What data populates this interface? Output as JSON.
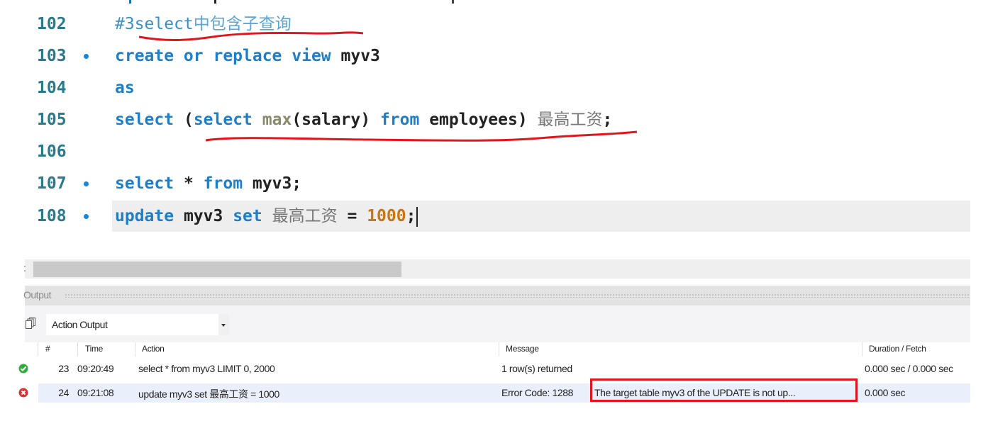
{
  "editor": {
    "lines": [
      {
        "number": "102",
        "breakpoint": false,
        "comment": "#3select中包含子查询"
      },
      {
        "number": "103",
        "breakpoint": true,
        "tokens": [
          "create or replace view",
          "myv3"
        ]
      },
      {
        "number": "104",
        "breakpoint": false,
        "tokens": [
          "as"
        ]
      },
      {
        "number": "105",
        "breakpoint": false,
        "tokens": [
          "select",
          "(",
          "select",
          "max",
          "(salary)",
          "from",
          "employees)",
          "最高工资",
          ";"
        ]
      },
      {
        "number": "106",
        "breakpoint": false,
        "tokens": []
      },
      {
        "number": "107",
        "breakpoint": true,
        "tokens": [
          "select",
          "*",
          "from",
          "myv3;"
        ]
      },
      {
        "number": "108",
        "breakpoint": true,
        "current": true,
        "tokens": [
          "update",
          "myv3",
          "set",
          "最高工资",
          "=",
          "1000",
          ";"
        ]
      }
    ]
  },
  "output_panel": {
    "title": "Output",
    "selector_value": "Action Output",
    "columns": [
      "#",
      "Time",
      "Action",
      "Message",
      "Duration / Fetch"
    ],
    "rows": [
      {
        "status": "success",
        "num": "23",
        "time": "09:20:49",
        "action": "select * from myv3 LIMIT 0, 2000",
        "message": "1 row(s) returned",
        "duration": "0.000 sec / 0.000 sec"
      },
      {
        "status": "error",
        "num": "24",
        "time": "09:21:08",
        "action": "update myv3 set 最高工资 = 1000",
        "message_code": "Error Code: 1288",
        "message": "The target table myv3 of the UPDATE is not up...",
        "duration": "0.000 sec"
      }
    ]
  },
  "colors": {
    "keyword": "#1d7fc9",
    "number": "#c87714",
    "annotation_red": "#e0161a",
    "success": "#2eae3a",
    "error": "#d93030"
  }
}
